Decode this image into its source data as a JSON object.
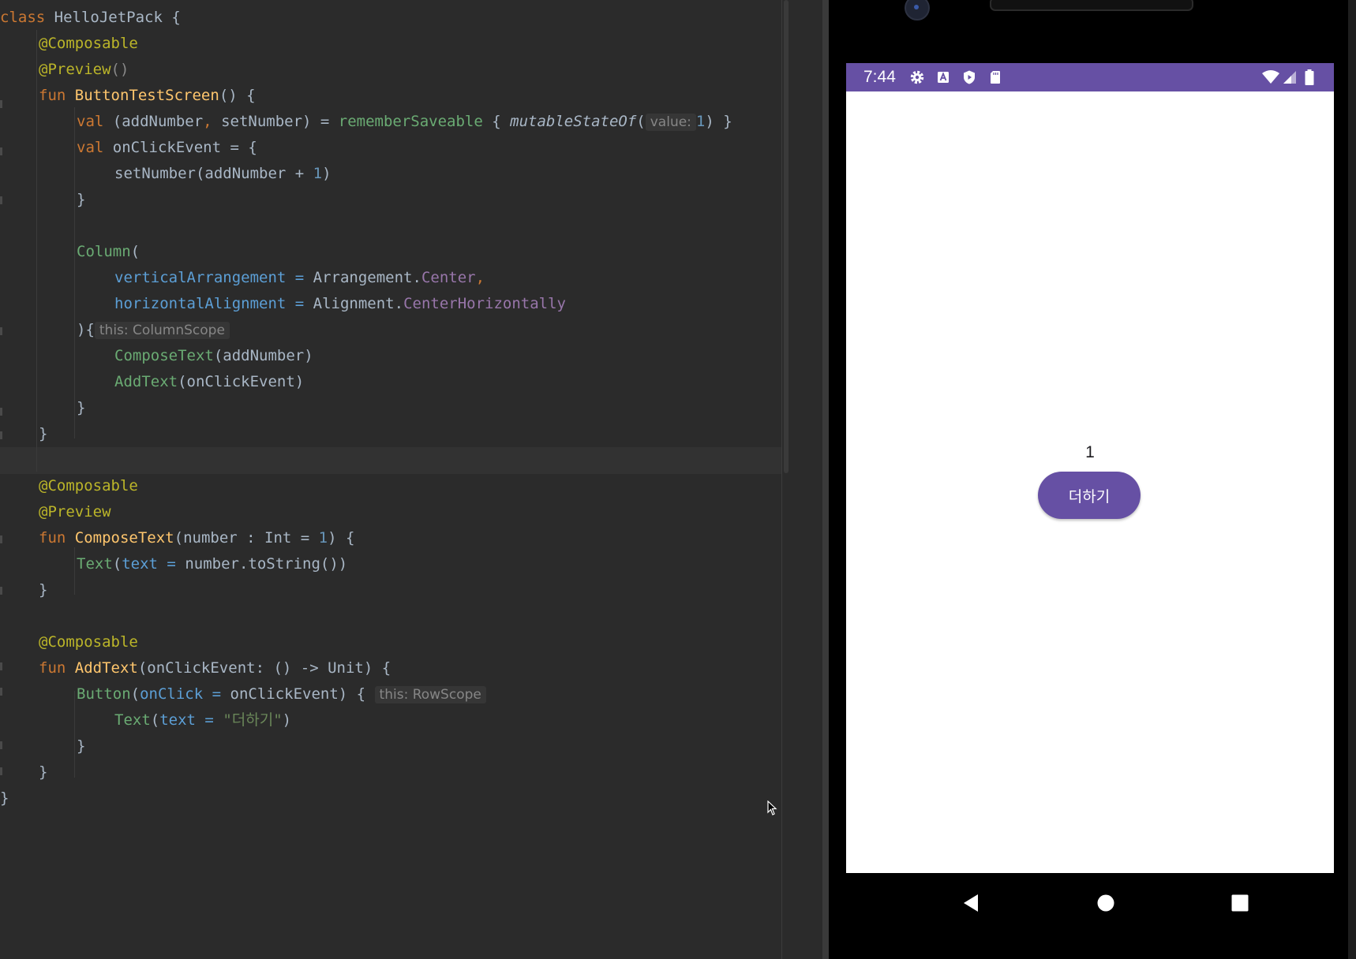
{
  "editor": {
    "lines": {
      "l1": {
        "kw": "class",
        "name": " HelloJetPack {"
      },
      "l2": {
        "ann": "@Composable"
      },
      "l3": {
        "ann": "@Preview",
        "rest": "()"
      },
      "l4": {
        "kw": "fun",
        "fn": "ButtonTestScreen",
        "rest": "() {"
      },
      "l5": {
        "kw": "val",
        "a": " (addNumber",
        "comma": ",",
        "b": " setNumber) = ",
        "call": "rememberSaveable",
        "c": " { ",
        "ital": "mutableStateOf",
        "d": "(",
        "hint": "value:",
        "num": "1",
        "e": ") }"
      },
      "l6": {
        "kw": "val",
        "rest": " onClickEvent = {"
      },
      "l7": {
        "a": "setNumber(addNumber + ",
        "num": "1",
        "b": ")"
      },
      "l8": {
        "rest": "}"
      },
      "l10": {
        "call": "Column",
        "rest": "("
      },
      "l11": {
        "param": "verticalArrangement",
        "eq": " = ",
        "obj": "Arrangement.",
        "prop": "Center",
        "comma": ","
      },
      "l12": {
        "param": "horizontalAlignment",
        "eq": " = ",
        "obj": "Alignment.",
        "prop": "CenterHorizontally"
      },
      "l13": {
        "rest": "){",
        "hint": "this: ColumnScope"
      },
      "l14": {
        "call": "ComposeText",
        "rest": "(addNumber)"
      },
      "l15": {
        "call": "AddText",
        "rest": "(onClickEvent)"
      },
      "l16": {
        "rest": "}"
      },
      "l17": {
        "rest": "}"
      },
      "l19": {
        "ann": "@Composable"
      },
      "l20": {
        "ann": "@Preview"
      },
      "l21": {
        "kw": "fun",
        "fn": "ComposeText",
        "a": "(number : Int = ",
        "num": "1",
        "b": ") {"
      },
      "l22": {
        "call": "Text",
        "a": "(",
        "param": "text",
        "eq": " = ",
        "b": "number.toString())"
      },
      "l23": {
        "rest": "}"
      },
      "l25": {
        "ann": "@Composable"
      },
      "l26": {
        "kw": "fun",
        "fn": "AddText",
        "rest": "(onClickEvent: () -> Unit) {"
      },
      "l27": {
        "call": "Button",
        "a": "(",
        "param": "onClick",
        "eq": " = ",
        "b": "onClickEvent) {",
        "hint": "this: RowScope"
      },
      "l28": {
        "call": "Text",
        "a": "(",
        "param": "text",
        "eq": " = ",
        "str": "\"더하기\"",
        "b": ")"
      },
      "l29": {
        "rest": "}"
      },
      "l30": {
        "rest": "}"
      },
      "l31": {
        "rest": "}"
      }
    }
  },
  "emulator": {
    "status_bar": {
      "time": "7:44",
      "icons": [
        "gear-icon",
        "font-a-icon",
        "shield-play-icon",
        "sd-card-icon",
        "wifi-icon",
        "signal-icon",
        "battery-icon"
      ],
      "color": "#6650a4"
    },
    "app": {
      "counter_value": "1",
      "button_label": "더하기",
      "accent_color": "#6650a4"
    },
    "nav": [
      "back-icon",
      "home-icon",
      "recents-icon"
    ]
  }
}
